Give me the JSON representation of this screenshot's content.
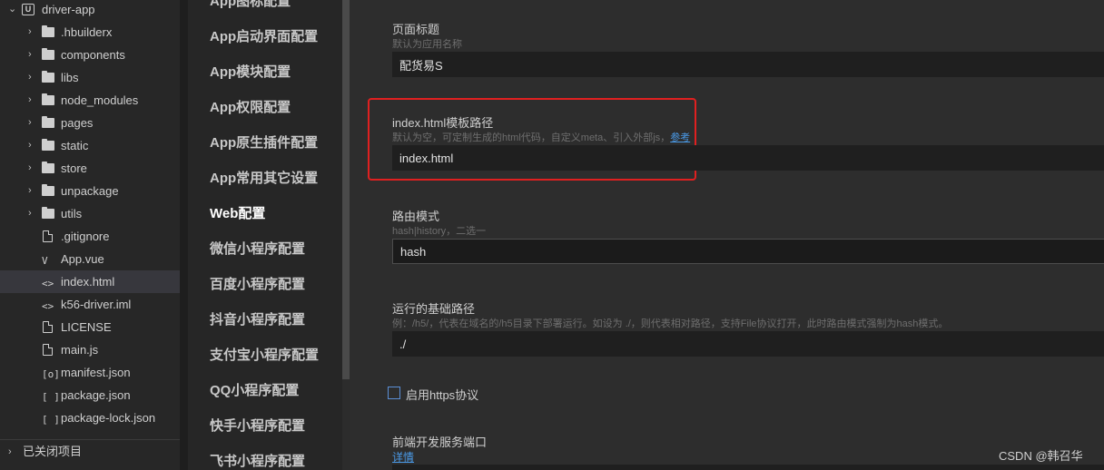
{
  "file_tree": {
    "project": {
      "name": "driver-app",
      "icon": "project-icon"
    },
    "items": [
      {
        "label": ".hbuilderx",
        "type": "folder"
      },
      {
        "label": "components",
        "type": "folder"
      },
      {
        "label": "libs",
        "type": "folder"
      },
      {
        "label": "node_modules",
        "type": "folder"
      },
      {
        "label": "pages",
        "type": "folder"
      },
      {
        "label": "static",
        "type": "folder"
      },
      {
        "label": "store",
        "type": "folder"
      },
      {
        "label": "unpackage",
        "type": "folder"
      },
      {
        "label": "utils",
        "type": "folder"
      },
      {
        "label": ".gitignore",
        "type": "file",
        "icon": "file-icon"
      },
      {
        "label": "App.vue",
        "type": "file",
        "icon": "vue-file-icon",
        "glyph": "V"
      },
      {
        "label": "index.html",
        "type": "file",
        "icon": "html-file-icon",
        "glyph": "<>",
        "selected": true
      },
      {
        "label": "k56-driver.iml",
        "type": "file",
        "icon": "xml-file-icon",
        "glyph": "<>"
      },
      {
        "label": "LICENSE",
        "type": "file",
        "icon": "file-icon"
      },
      {
        "label": "main.js",
        "type": "file",
        "icon": "js-file-icon"
      },
      {
        "label": "manifest.json",
        "type": "file",
        "icon": "manifest-file-icon",
        "glyph": "[o]"
      },
      {
        "label": "package.json",
        "type": "file",
        "icon": "json-file-icon",
        "glyph": "[ ]"
      },
      {
        "label": "package-lock.json",
        "type": "file",
        "icon": "json-file-icon",
        "glyph": "[ ]"
      }
    ],
    "closed_projects": "已关闭项目"
  },
  "config_nav": {
    "items": [
      {
        "label": "App图标配置"
      },
      {
        "label": "App启动界面配置"
      },
      {
        "label": "App模块配置"
      },
      {
        "label": "App权限配置"
      },
      {
        "label": "App原生插件配置"
      },
      {
        "label": "App常用其它设置"
      },
      {
        "label": "Web配置",
        "active": true
      },
      {
        "label": "微信小程序配置"
      },
      {
        "label": "百度小程序配置"
      },
      {
        "label": "抖音小程序配置"
      },
      {
        "label": "支付宝小程序配置"
      },
      {
        "label": "QQ小程序配置"
      },
      {
        "label": "快手小程序配置"
      },
      {
        "label": "飞书小程序配置"
      }
    ]
  },
  "form": {
    "page_title": {
      "label": "页面标题",
      "hint": "默认为应用名称",
      "value": "配货易S"
    },
    "template_path": {
      "label": "index.html模板路径",
      "hint": "默认为空，可定制生成的html代码，自定义meta、引入外部js，",
      "hint_link": "参考",
      "value": "index.html"
    },
    "router_mode": {
      "label": "路由模式",
      "hint": "hash|history，二选一",
      "value": "hash"
    },
    "base_path": {
      "label": "运行的基础路径",
      "hint": "例：/h5/，代表在域名的/h5目录下部署运行。如设为 ./，则代表相对路径，支持File协议打开，此时路由模式强制为hash模式。",
      "value": "./"
    },
    "https": {
      "label": "启用https协议",
      "checked": false
    },
    "dev_port": {
      "label": "前端开发服务端口",
      "link": "详情"
    }
  },
  "watermark": "CSDN @韩召华",
  "colors": {
    "highlight": "#e02020",
    "link": "#4a9ae8",
    "checkbox": "#5b8fd6"
  }
}
